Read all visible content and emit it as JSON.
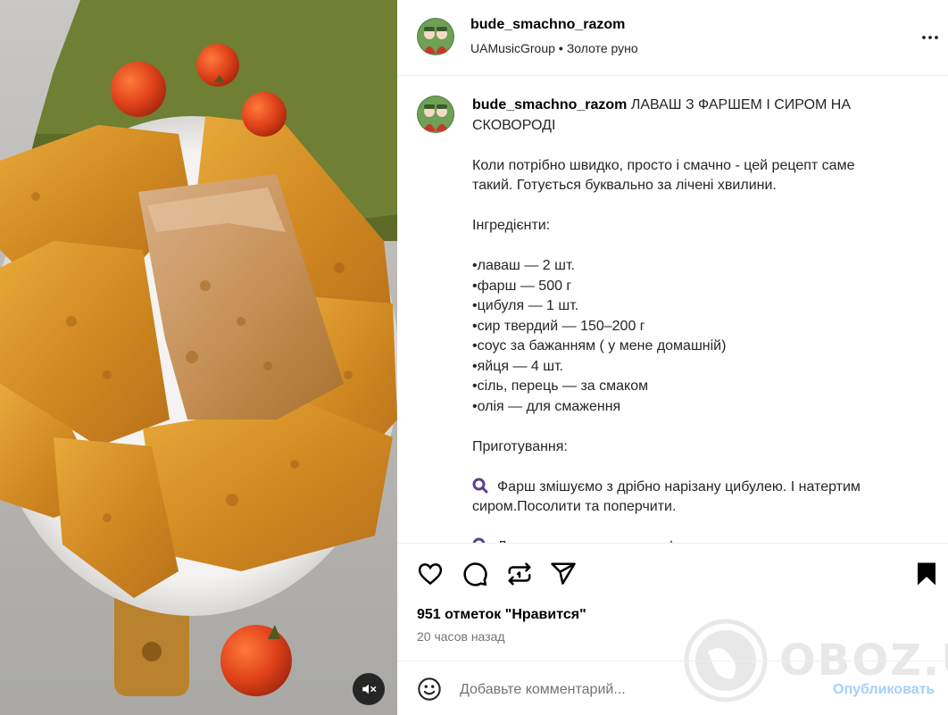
{
  "header": {
    "username": "bude_smachno_razom",
    "audio_artist": "UAMusicGroup",
    "audio_track": "Золоте руно"
  },
  "caption": {
    "username": "bude_smachno_razom",
    "title": "ЛАВАШ З ФАРШЕМ І СИРОМ НА СКОВОРОДІ",
    "intro": "Коли потрібно швидко, просто і смачно - цей рецепт саме такий. Готується буквально за лічені хвилини.",
    "ingredients_heading": "Інгредієнти:",
    "ingredients": [
      "•лаваш — 2 шт.",
      "•фарш — 500 г",
      "•цибуля — 1 шт.",
      "•сир твердий — 150–200 г",
      "•соус за бажанням ( у мене домашній)",
      "•яйця — 4 шт.",
      "•сіль, перець — за смаком",
      "•олія — для смаження"
    ],
    "method_heading": "Приготування:",
    "step1": "Фарш змішуємо з дрібно нарізану цибулею. І натертим сиром.Посолити та поперчити.",
    "step2_partial": "Л                                        ф"
  },
  "likes_text": "951 отметок \"Нравится\"",
  "time_text": "20 часов назад",
  "comment": {
    "placeholder": "Добавьте комментарий...",
    "publish_label": "Опубликовать"
  },
  "watermark": "OBOZ.UA",
  "colors": {
    "publish_disabled": "#a5cffb",
    "step_icon": "#5b3f8f",
    "text_secondary": "#737373"
  },
  "icons": {
    "more": "more-horizontal-icon",
    "like": "heart-icon",
    "comment": "comment-bubble-icon",
    "repost": "repost-icon",
    "share": "paper-plane-icon",
    "save": "bookmark-filled-icon",
    "emoji": "smiley-icon",
    "mute": "speaker-muted-icon",
    "step": "magnifier-bullet-icon"
  }
}
